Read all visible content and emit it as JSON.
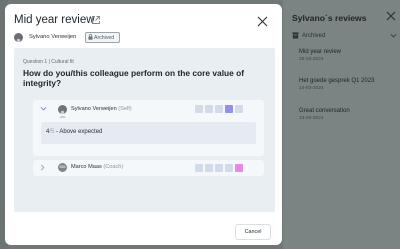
{
  "modal": {
    "title": "Mid year review",
    "user_name": "Sylvano Verweijen",
    "status_badge": "Archived",
    "cancel_label": "Cancel"
  },
  "question": {
    "category": "Question 1 | Cultural fit",
    "text": "How do you/this colleague perform on the core value of integrity?"
  },
  "responses": [
    {
      "name": "Sylvano Verweijen",
      "role": "(Self)",
      "expanded": true,
      "selected_rating": 4,
      "scale_max": 5,
      "answer_value": "4",
      "answer_max": "/5",
      "answer_label": "- Above expected"
    },
    {
      "name": "Marco Maas",
      "role": "(Coach)",
      "initials": "MM",
      "expanded": false,
      "selected_rating": 5,
      "scale_max": 5
    }
  ],
  "side_panel": {
    "title": "Sylvano´s reviews",
    "filter_label": "Archived",
    "reviews": [
      {
        "title": "Mid year review",
        "date": "25-10-2024"
      },
      {
        "title": "Het goede gesprek Q1 2023",
        "date": "14-03-2024"
      },
      {
        "title": "Great conversation",
        "date": "13-03-2024"
      }
    ]
  },
  "colors": {
    "rating_self": "#8f92ec",
    "rating_coach": "#e889e3",
    "rating_empty": "#d3dbe8"
  }
}
